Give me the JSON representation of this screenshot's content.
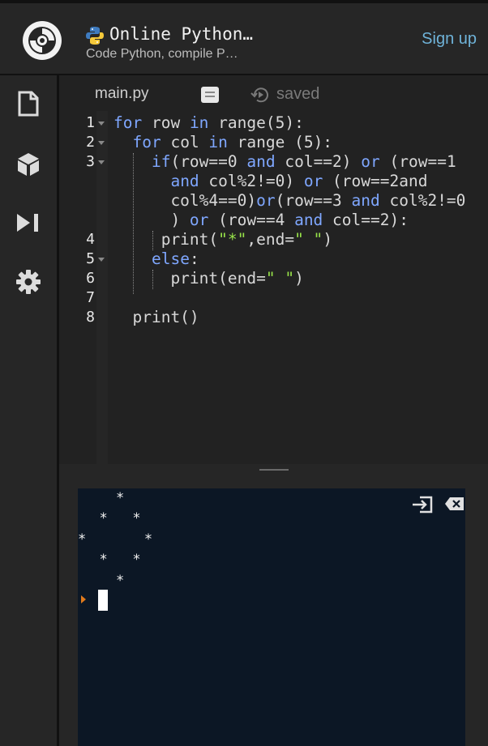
{
  "header": {
    "title": "Online Python…",
    "subtitle": "Code Python, compile P…",
    "sign_up": "Sign up"
  },
  "sidebar": {
    "items": [
      {
        "icon": "file-icon"
      },
      {
        "icon": "package-icon"
      },
      {
        "icon": "run-icon"
      },
      {
        "icon": "gear-icon"
      }
    ]
  },
  "editor": {
    "tab_name": "main.py",
    "save_status": "saved",
    "line_numbers": [
      "1",
      "2",
      "3",
      "4",
      "5",
      "6",
      "7",
      "8"
    ],
    "code": [
      "for row in range(5):",
      "  for col in range (5):",
      "    if(row==0 and col==2) or (row==1",
      "      and col%2!=0) or (row==2and",
      "      col%4==0)or(row==3 and col%2!=0",
      "      ) or (row==4 and col==2):",
      "     print(\"*\",end=\" \")",
      "    else:",
      "      print(end=\" \")",
      "",
      "  print()"
    ]
  },
  "terminal": {
    "output": [
      "    *",
      "  *   *",
      "*       *",
      "  *   *",
      "    *"
    ]
  },
  "colors": {
    "background": "#262626",
    "editor_bg": "#222222",
    "terminal_bg": "#0c1725",
    "keyword": "#7fa7ff",
    "string": "#98e34a",
    "link": "#6fb3d9",
    "prompt": "#e07a1c"
  }
}
